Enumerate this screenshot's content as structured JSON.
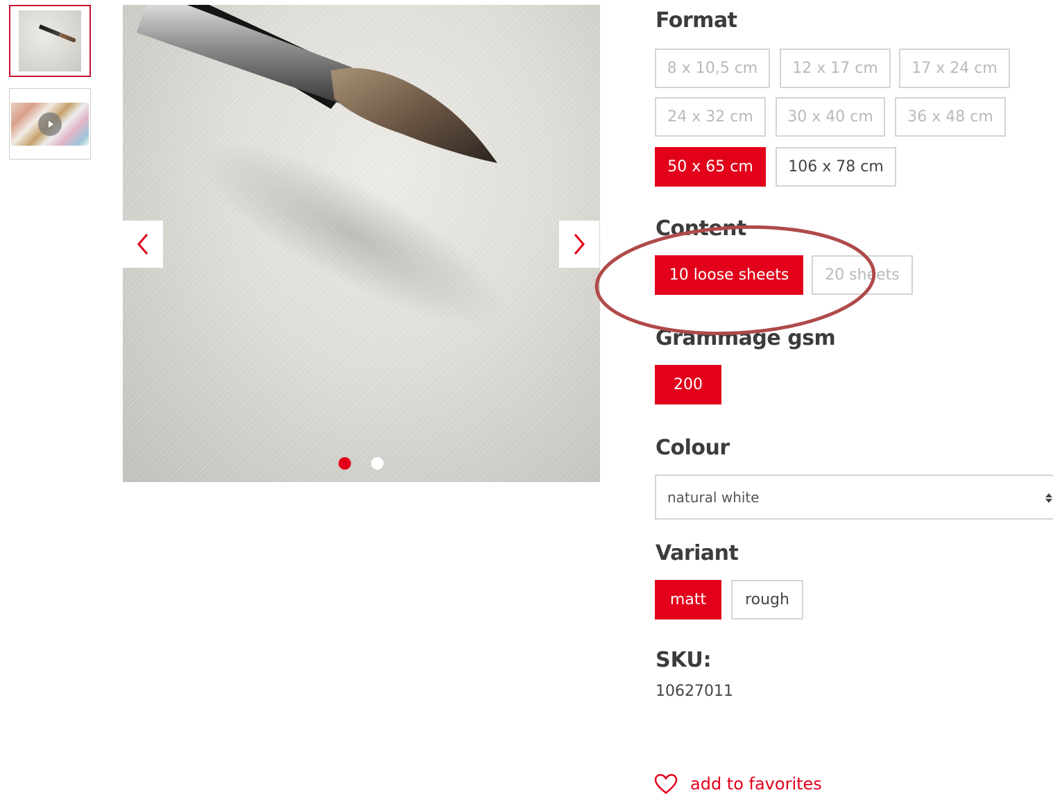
{
  "gallery": {
    "thumbnails": [
      {
        "icon": "paper-brush-thumbnail"
      },
      {
        "icon": "video-thumbnail"
      }
    ],
    "prev_icon": "chevron-left-icon",
    "next_icon": "chevron-right-icon",
    "dots": 2,
    "active_dot": 1
  },
  "format": {
    "title": "Format",
    "options": [
      {
        "label": "8 x 10,5 cm",
        "state": "unavailable"
      },
      {
        "label": "12 x 17 cm",
        "state": "unavailable"
      },
      {
        "label": "17 x 24 cm",
        "state": "unavailable"
      },
      {
        "label": "24 x 32 cm",
        "state": "unavailable"
      },
      {
        "label": "30 x 40 cm",
        "state": "unavailable"
      },
      {
        "label": "36 x 48 cm",
        "state": "unavailable"
      },
      {
        "label": "50 x 65 cm",
        "state": "selected"
      },
      {
        "label": "106 x 78 cm",
        "state": "available"
      }
    ]
  },
  "content": {
    "title": "Content",
    "options": [
      {
        "label": "10 loose sheets",
        "state": "selected"
      },
      {
        "label": "20 sheets",
        "state": "unavailable"
      }
    ]
  },
  "grammage": {
    "title": "Grammage gsm",
    "options": [
      {
        "label": "200",
        "state": "selected"
      }
    ]
  },
  "colour": {
    "title": "Colour",
    "selected": "natural white"
  },
  "variant": {
    "title": "Variant",
    "options": [
      {
        "label": "matt",
        "state": "selected"
      },
      {
        "label": "rough",
        "state": "available"
      }
    ]
  },
  "sku": {
    "label": "SKU:",
    "value": "10627011"
  },
  "favorites": {
    "label": "add to favorites",
    "icon": "heart-icon"
  },
  "colors": {
    "accent": "#e2001a",
    "annotation": "#b04a4a"
  }
}
